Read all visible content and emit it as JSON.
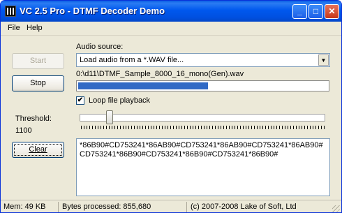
{
  "window": {
    "title": "VC 2.5 Pro - DTMF Decoder Demo",
    "controls": {
      "minimize": "_",
      "maximize": "□",
      "close": "✕"
    }
  },
  "menu": {
    "file": "File",
    "help": "Help"
  },
  "buttons": {
    "start": "Start",
    "stop": "Stop",
    "clear": "Clear"
  },
  "audio": {
    "label": "Audio source:",
    "selected": "Load audio from a *.WAV file...",
    "file_path": "0:\\d11\\DTMF_Sample_8000_16_mono(Gen).wav",
    "progress_fraction": 0.52
  },
  "loop": {
    "label": "Loop file playback",
    "checked": true,
    "check_glyph": "✔"
  },
  "threshold": {
    "label": "Threshold:",
    "value": "1100",
    "slider_fraction": 0.11
  },
  "output": {
    "text": "*86B90#CD753241*86AB90#CD753241*86AB90#CD753241*86AB90#CD753241*86B90#CD753241*86B90#CD753241*86B90#"
  },
  "status": {
    "memory": "Mem: 49 KB",
    "bytes": "Bytes processed: 855,680",
    "copyright": "(c) 2007-2008 Lake of Soft, Ltd"
  },
  "colors": {
    "title_bar": "#0058ee",
    "progress": "#316ac5",
    "window_bg": "#ece9d8"
  }
}
